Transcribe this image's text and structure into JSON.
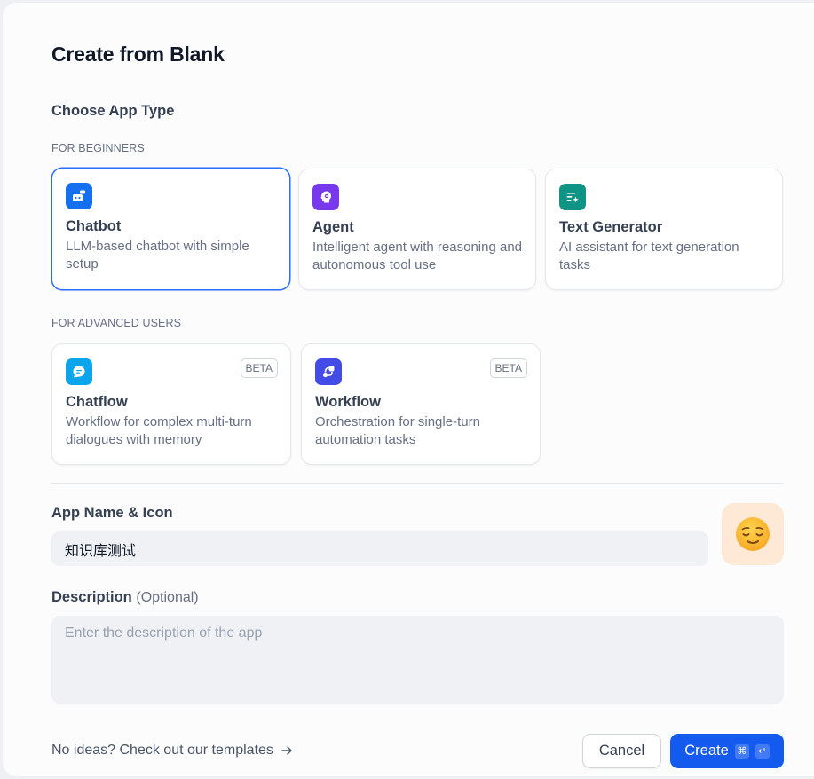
{
  "dialog": {
    "title": "Create from Blank",
    "choose_type_label": "Choose App Type",
    "beginners_label": "FOR BEGINNERS",
    "advanced_label": "FOR ADVANCED USERS"
  },
  "app_types": {
    "beginners": [
      {
        "name": "Chatbot",
        "description": "LLM-based chatbot with simple setup",
        "icon": "chatbot-icon",
        "color": "#1570ef",
        "selected": true
      },
      {
        "name": "Agent",
        "description": "Intelligent agent with reasoning and autonomous tool use",
        "icon": "agent-icon",
        "color": "#7839ee"
      },
      {
        "name": "Text Generator",
        "description": "AI assistant for text generation tasks",
        "icon": "text-generator-icon",
        "color": "#0e9384"
      }
    ],
    "advanced": [
      {
        "name": "Chatflow",
        "description": "Workflow for complex multi-turn dialogues with memory",
        "icon": "chatflow-icon",
        "color": "#0ba5ec",
        "badge": "BETA"
      },
      {
        "name": "Workflow",
        "description": "Orchestration for single-turn automation tasks",
        "icon": "workflow-icon",
        "color": "#444ce7",
        "badge": "BETA"
      }
    ]
  },
  "form": {
    "name_label": "App Name & Icon",
    "name_value": "知识库测试",
    "app_icon": "relieved-face-emoji",
    "app_icon_background": "#fde9d6",
    "description_label": "Description",
    "description_optional": "(Optional)",
    "description_placeholder": "Enter the description of the app",
    "description_value": ""
  },
  "footer": {
    "templates_link": "No ideas? Check out our templates",
    "cancel_label": "Cancel",
    "create_label": "Create",
    "shortcut_keys": [
      "⌘",
      "↵"
    ]
  },
  "colors": {
    "accent": "#155aef",
    "selected_border": "#296dff"
  }
}
